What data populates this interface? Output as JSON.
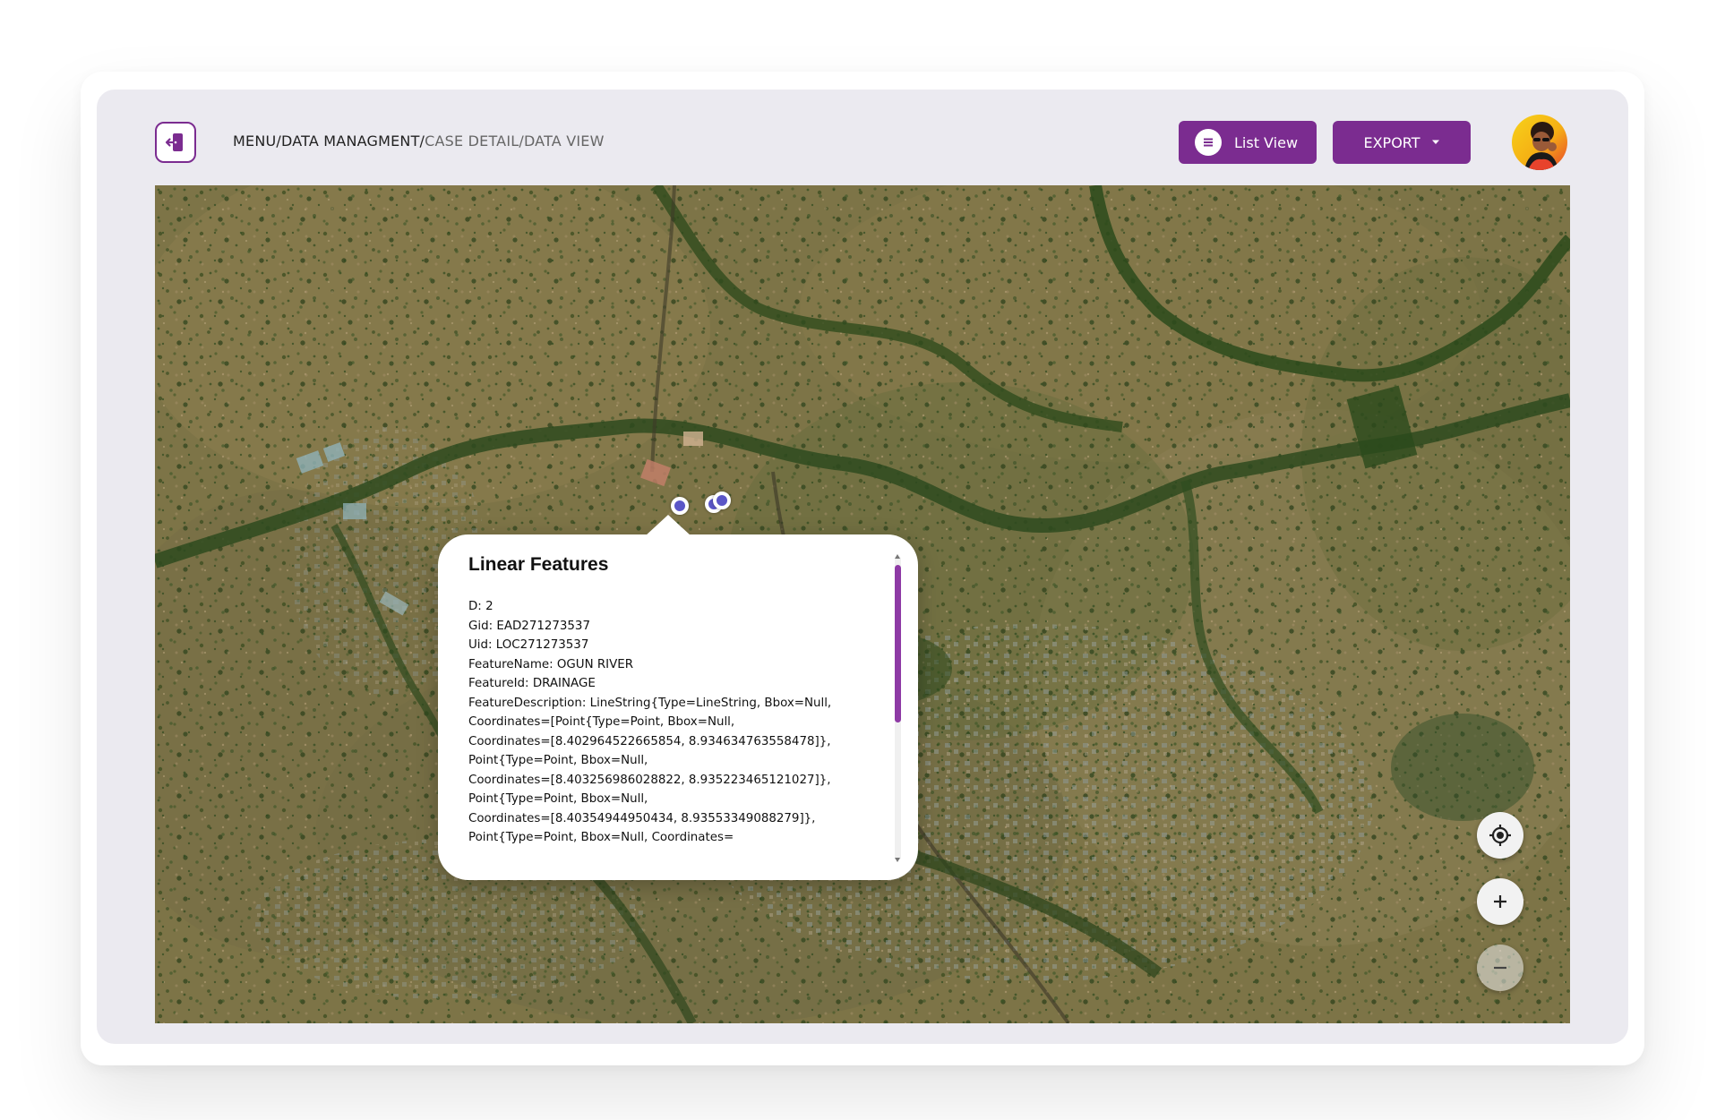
{
  "header": {
    "breadcrumb": {
      "part1": "MENU",
      "sep1": "/",
      "part2": "DATA MANAGMENT",
      "sep2": "/",
      "part3": "CASE DETAIL/DATA VIEW"
    },
    "list_view_label": "List View",
    "export_label": "EXPORT"
  },
  "icons": {
    "back": "exit-door-icon",
    "list": "list-icon",
    "export_caret": "caret-down-icon",
    "locate": "locate-target-icon",
    "zoom_in": "plus-icon",
    "zoom_out": "minus-icon"
  },
  "colors": {
    "brand": "#7b2c90",
    "marker": "#5b56c7",
    "frame": "#ebeaf0"
  },
  "popup": {
    "title": "Linear Features",
    "lines": [
      "D: 2",
      "Gid: EAD271273537",
      "Uid: LOC271273537",
      "FeatureName: OGUN RIVER",
      "FeatureId: DRAINAGE",
      "FeatureDescription: LineString{Type=LineString, Bbox=Null,",
      "Coordinates=[Point{Type=Point, Bbox=Null,",
      "Coordinates=[8.402964522665854, 8.934634763558478]},",
      "Point{Type=Point, Bbox=Null,",
      "Coordinates=[8.403256986028822, 8.935223465121027]},",
      "Point{Type=Point, Bbox=Null,",
      "Coordinates=[8.40354944950434, 8.93553349088279]},",
      "Point{Type=Point, Bbox=Null, Coordinates="
    ]
  }
}
